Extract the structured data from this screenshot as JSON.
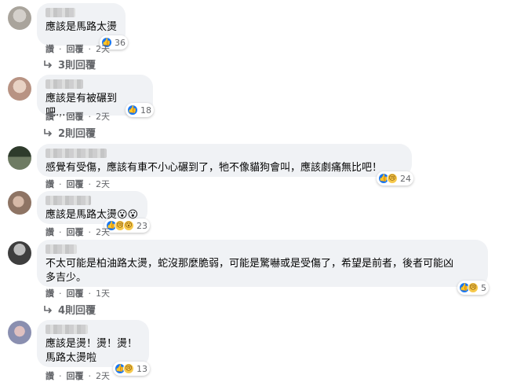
{
  "comments": [
    {
      "text": "應該是馬路太燙",
      "reaction_count": "36",
      "reactions": [
        "like"
      ],
      "actions": {
        "like": "讚",
        "reply": "回覆",
        "time": "2天"
      },
      "replies": "3則回覆"
    },
    {
      "text": "應該是有被碾到吧......",
      "reaction_count": "18",
      "reactions": [
        "like"
      ],
      "actions": {
        "like": "讚",
        "reply": "回覆",
        "time": "2天"
      },
      "replies": "2則回覆"
    },
    {
      "text": "感覺有受傷，應該有車不小心碾到了，牠不像貓狗會叫，應該劇痛無比吧！",
      "reaction_count": "24",
      "reactions": [
        "like",
        "sad"
      ],
      "actions": {
        "like": "讚",
        "reply": "回覆",
        "time": "2天"
      }
    },
    {
      "text": "應該是馬路太燙😮😮",
      "reaction_count": "23",
      "reactions": [
        "like",
        "sad",
        "wow"
      ],
      "actions": {
        "like": "讚",
        "reply": "回覆",
        "time": "2天"
      }
    },
    {
      "text": "不太可能是柏油路太燙，蛇沒那麼脆弱，可能是驚嚇或是受傷了，希望是前者，後者可能凶\n多吉少。",
      "reaction_count": "5",
      "reactions": [
        "like",
        "sad"
      ],
      "actions": {
        "like": "讚",
        "reply": "回覆",
        "time": "1天"
      },
      "replies": "4則回覆"
    },
    {
      "text": "應該是燙！燙！燙！\n馬路太燙啦",
      "reaction_count": "13",
      "reactions": [
        "like",
        "sad"
      ],
      "actions": {
        "like": "讚",
        "reply": "回覆",
        "time": "2天"
      }
    }
  ],
  "icons": {
    "like": "👍",
    "sad": "😢",
    "wow": "😮",
    "haha": "😆",
    "reply_arrow": "reply-arrow-icon"
  },
  "colors": {
    "bubble": "#f0f2f5",
    "meta_text": "#65676b",
    "like_blue": "#1877f2",
    "emoji_yellow": "#f7c94b"
  }
}
